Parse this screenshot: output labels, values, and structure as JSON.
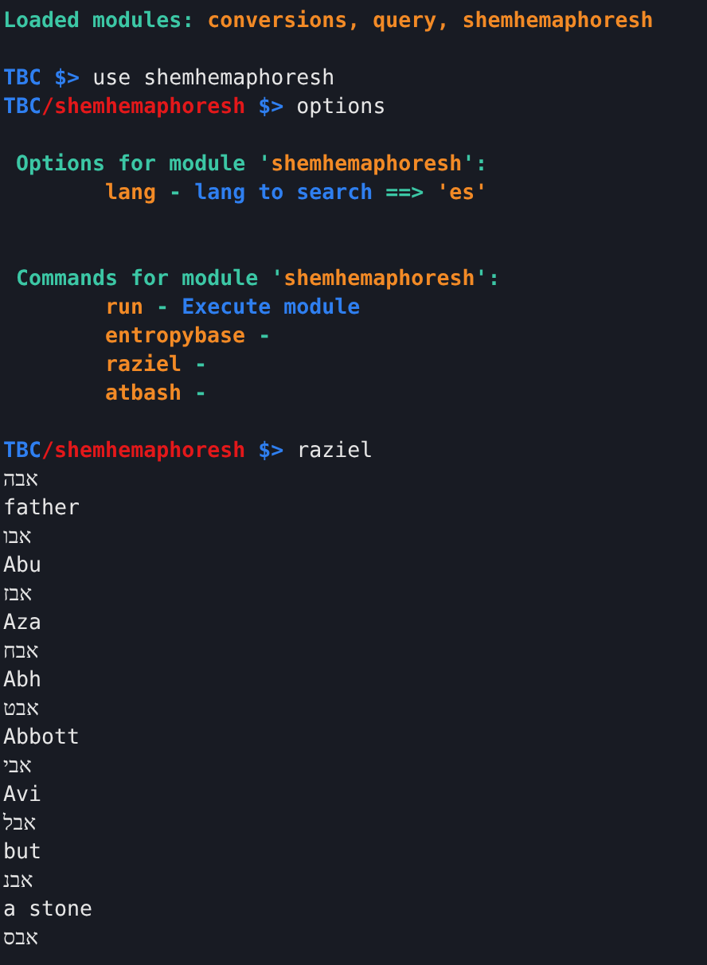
{
  "terminal": {
    "lines": [
      {
        "kind": "banner",
        "segments": [
          {
            "kind": "label",
            "text": "Loaded modules: "
          },
          {
            "kind": "value",
            "text": "conversions, query, shemhemaphoresh"
          }
        ]
      },
      {
        "kind": "blank"
      },
      {
        "kind": "prompt",
        "segments": [
          {
            "kind": "host",
            "text": "TBC"
          },
          {
            "kind": "symbol",
            "text": " $> "
          },
          {
            "kind": "input",
            "text": "use shemhemaphoresh"
          }
        ]
      },
      {
        "kind": "prompt",
        "segments": [
          {
            "kind": "host",
            "text": "TBC"
          },
          {
            "kind": "module",
            "text": "/shemhemaphoresh"
          },
          {
            "kind": "symbol",
            "text": " $> "
          },
          {
            "kind": "input",
            "text": "options"
          }
        ]
      },
      {
        "kind": "blank"
      },
      {
        "kind": "heading",
        "segments": [
          {
            "kind": "label",
            "text": "Options for module '"
          },
          {
            "kind": "value",
            "text": "shemhemaphoresh"
          },
          {
            "kind": "label",
            "text": "':"
          }
        ]
      },
      {
        "kind": "entry",
        "segments": [
          {
            "kind": "value",
            "text": "lang"
          },
          {
            "kind": "label",
            "text": " - "
          },
          {
            "kind": "symbol",
            "text": "lang to search"
          },
          {
            "kind": "label",
            "text": " ==> "
          },
          {
            "kind": "value",
            "text": "'es'"
          }
        ]
      },
      {
        "kind": "blank"
      },
      {
        "kind": "blank"
      },
      {
        "kind": "heading",
        "segments": [
          {
            "kind": "label",
            "text": "Commands for module '"
          },
          {
            "kind": "value",
            "text": "shemhemaphoresh"
          },
          {
            "kind": "label",
            "text": "':"
          }
        ]
      },
      {
        "kind": "entry",
        "segments": [
          {
            "kind": "value",
            "text": "run"
          },
          {
            "kind": "label",
            "text": " - "
          },
          {
            "kind": "symbol",
            "text": "Execute module"
          }
        ]
      },
      {
        "kind": "entry",
        "segments": [
          {
            "kind": "value",
            "text": "entropybase"
          },
          {
            "kind": "label",
            "text": " -"
          }
        ]
      },
      {
        "kind": "entry",
        "segments": [
          {
            "kind": "value",
            "text": "raziel"
          },
          {
            "kind": "label",
            "text": " -"
          }
        ]
      },
      {
        "kind": "entry",
        "segments": [
          {
            "kind": "value",
            "text": "atbash"
          },
          {
            "kind": "label",
            "text": " -"
          }
        ]
      },
      {
        "kind": "blank"
      },
      {
        "kind": "prompt",
        "segments": [
          {
            "kind": "host",
            "text": "TBC"
          },
          {
            "kind": "module",
            "text": "/shemhemaphoresh"
          },
          {
            "kind": "symbol",
            "text": " $> "
          },
          {
            "kind": "input",
            "text": "raziel"
          }
        ]
      },
      {
        "kind": "output",
        "segments": [
          {
            "kind": "input",
            "text": "אבה"
          }
        ]
      },
      {
        "kind": "output",
        "segments": [
          {
            "kind": "input",
            "text": "father"
          }
        ]
      },
      {
        "kind": "output",
        "segments": [
          {
            "kind": "input",
            "text": "אבו"
          }
        ]
      },
      {
        "kind": "output",
        "segments": [
          {
            "kind": "input",
            "text": "Abu"
          }
        ]
      },
      {
        "kind": "output",
        "segments": [
          {
            "kind": "input",
            "text": "אבז"
          }
        ]
      },
      {
        "kind": "output",
        "segments": [
          {
            "kind": "input",
            "text": "Aza"
          }
        ]
      },
      {
        "kind": "output",
        "segments": [
          {
            "kind": "input",
            "text": "אבח"
          }
        ]
      },
      {
        "kind": "output",
        "segments": [
          {
            "kind": "input",
            "text": "Abh"
          }
        ]
      },
      {
        "kind": "output",
        "segments": [
          {
            "kind": "input",
            "text": "אבט"
          }
        ]
      },
      {
        "kind": "output",
        "segments": [
          {
            "kind": "input",
            "text": "Abbott"
          }
        ]
      },
      {
        "kind": "output",
        "segments": [
          {
            "kind": "input",
            "text": "אבי"
          }
        ]
      },
      {
        "kind": "output",
        "segments": [
          {
            "kind": "input",
            "text": "Avi"
          }
        ]
      },
      {
        "kind": "output",
        "segments": [
          {
            "kind": "input",
            "text": "אבל"
          }
        ]
      },
      {
        "kind": "output",
        "segments": [
          {
            "kind": "input",
            "text": "but"
          }
        ]
      },
      {
        "kind": "output",
        "segments": [
          {
            "kind": "input",
            "text": "אבנ"
          }
        ]
      },
      {
        "kind": "output",
        "segments": [
          {
            "kind": "input",
            "text": "a stone"
          }
        ]
      },
      {
        "kind": "output",
        "segments": [
          {
            "kind": "input",
            "text": "אבס"
          }
        ]
      }
    ]
  }
}
